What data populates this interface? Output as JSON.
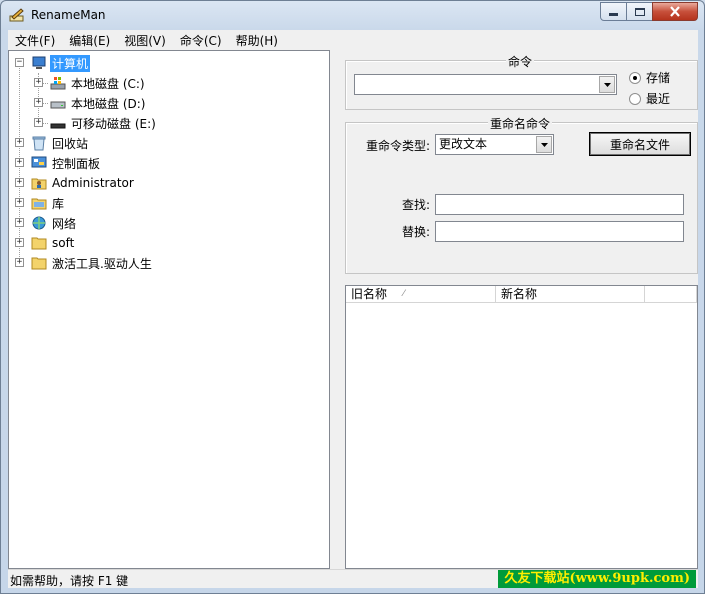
{
  "window": {
    "title": "RenameMan"
  },
  "menu": [
    "文件(F)",
    "编辑(E)",
    "视图(V)",
    "命令(C)",
    "帮助(H)"
  ],
  "tree": {
    "root": {
      "label": "计算机",
      "icon": "computer-icon",
      "expander": "−"
    },
    "drives": [
      {
        "label": "本地磁盘 (C:)",
        "icon": "system-drive-icon",
        "expander": "+"
      },
      {
        "label": "本地磁盘 (D:)",
        "icon": "drive-icon",
        "expander": "+"
      },
      {
        "label": "可移动磁盘 (E:)",
        "icon": "removable-drive-icon",
        "expander": "+"
      }
    ],
    "items": [
      {
        "label": "回收站",
        "icon": "recycle-bin-icon",
        "expander": "+"
      },
      {
        "label": "控制面板",
        "icon": "control-panel-icon",
        "expander": "+"
      },
      {
        "label": "Administrator",
        "icon": "user-folder-icon",
        "expander": "+"
      },
      {
        "label": "库",
        "icon": "library-icon",
        "expander": "+"
      },
      {
        "label": "网络",
        "icon": "network-icon",
        "expander": "+"
      },
      {
        "label": "soft",
        "icon": "folder-icon",
        "expander": "+"
      },
      {
        "label": "激活工具.驱动人生",
        "icon": "folder-icon",
        "expander": "+"
      }
    ]
  },
  "command_group": {
    "title": "命令",
    "command_value": "",
    "radio_save": "存储",
    "radio_recent": "最近",
    "selected": "save"
  },
  "rename_group": {
    "title": "重命名命令",
    "type_label": "重命令类型:",
    "type_value": "更改文本",
    "rename_button": "重命名文件",
    "find_label": "查找:",
    "replace_label": "替换:",
    "find_value": "",
    "replace_value": ""
  },
  "list": {
    "columns": [
      "旧名称",
      "新名称",
      ""
    ]
  },
  "status": {
    "text": "如需帮助，请按 F1 键",
    "watermark": "久友下载站(www.9upk.com)"
  }
}
